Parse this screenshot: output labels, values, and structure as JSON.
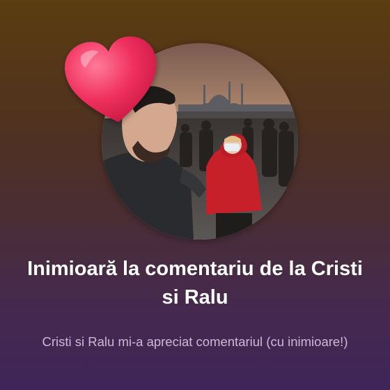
{
  "notification": {
    "title": "Inimioară la comentariu de la Cristi si Ralu",
    "body": "Cristi si Ralu mi-a apreciat comentariul (cu inimioare!)"
  },
  "icons": {
    "reaction": "heart-icon"
  },
  "colors": {
    "background_top": "#5a3d10",
    "background_bottom": "#3f2559",
    "heart": "#f0305f",
    "title_text": "#ffffff",
    "body_text": "#cdb9d3"
  }
}
